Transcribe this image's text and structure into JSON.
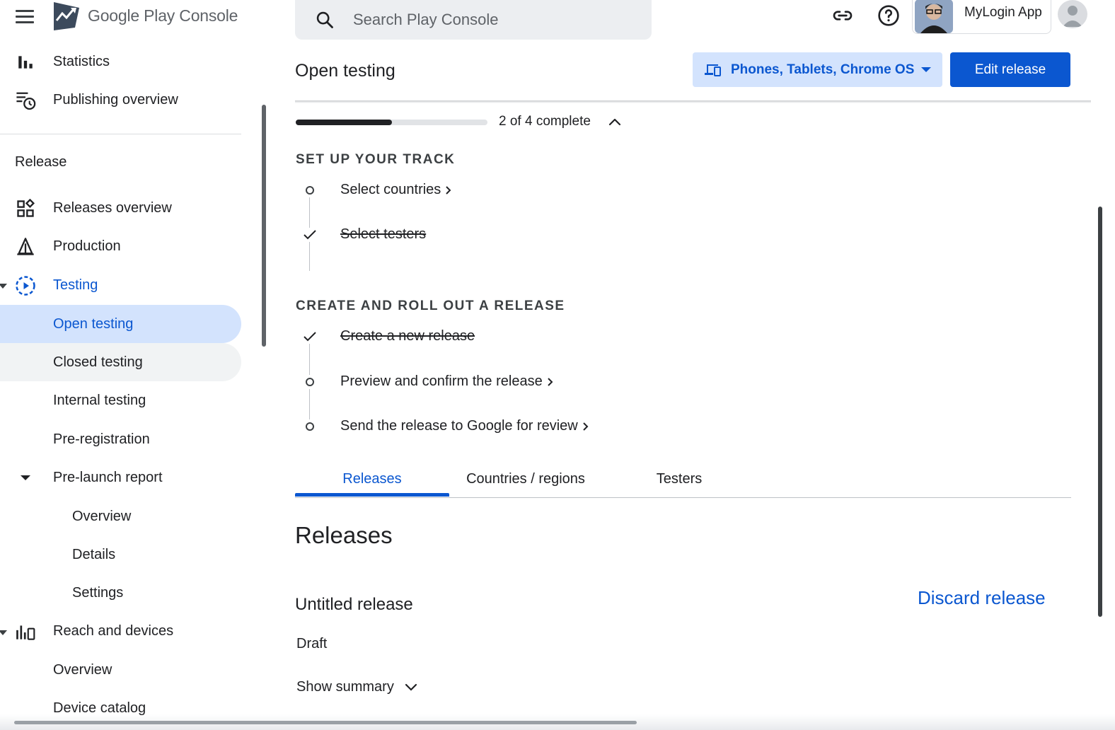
{
  "topbar": {
    "app_title": "Google Play Console",
    "search_placeholder": "Search Play Console",
    "app_name": "MyLogin App",
    "icons": [
      "menu-icon",
      "play-console-logo",
      "search-icon",
      "link-icon",
      "help-icon",
      "app-icon",
      "account-avatar-icon"
    ]
  },
  "sidebar": {
    "top_items": [
      {
        "label": "Statistics",
        "icon": "bar-chart-icon"
      },
      {
        "label": "Publishing overview",
        "icon": "publishing-history-icon"
      }
    ],
    "section_title": "Release",
    "items": [
      {
        "label": "Releases overview",
        "icon": "dashboard-grid-icon"
      },
      {
        "label": "Production",
        "icon": "production-icon"
      },
      {
        "label": "Testing",
        "icon": "testing-play-icon",
        "expanded": true
      },
      {
        "label": "Open testing",
        "selected": true
      },
      {
        "label": "Closed testing"
      },
      {
        "label": "Internal testing"
      },
      {
        "label": "Pre-registration"
      },
      {
        "label": "Pre-launch report",
        "expanded": true
      },
      {
        "label": "Overview"
      },
      {
        "label": "Details"
      },
      {
        "label": "Settings"
      },
      {
        "label": "Reach and devices",
        "icon": "reach-chart-icon"
      },
      {
        "label": "Overview"
      },
      {
        "label": "Device catalog"
      }
    ]
  },
  "header": {
    "page_title": "Open testing",
    "device_filter": "Phones, Tablets, Chrome OS",
    "edit_button": "Edit release"
  },
  "progress": {
    "text": "2 of 4 complete",
    "fraction": 0.5
  },
  "setup": {
    "heading_track": "SET UP YOUR TRACK",
    "track_steps": [
      {
        "label": "Select countries",
        "done": false
      },
      {
        "label": "Select testers",
        "done": true
      }
    ],
    "heading_release": "CREATE AND ROLL OUT A RELEASE",
    "release_steps": [
      {
        "label": "Create a new release",
        "done": true
      },
      {
        "label": "Preview and confirm the release",
        "done": false
      },
      {
        "label": "Send the release to Google for review",
        "done": false
      }
    ]
  },
  "tabs": [
    {
      "label": "Releases",
      "active": true
    },
    {
      "label": "Countries / regions",
      "active": false
    },
    {
      "label": "Testers",
      "active": false
    }
  ],
  "releases": {
    "title": "Releases",
    "release_name": "Untitled release",
    "discard_label": "Discard release",
    "status": "Draft",
    "show_summary": "Show summary"
  },
  "colors": {
    "accent": "#0b57d0",
    "accent_container": "#d3e3fd",
    "text": "#202124"
  }
}
